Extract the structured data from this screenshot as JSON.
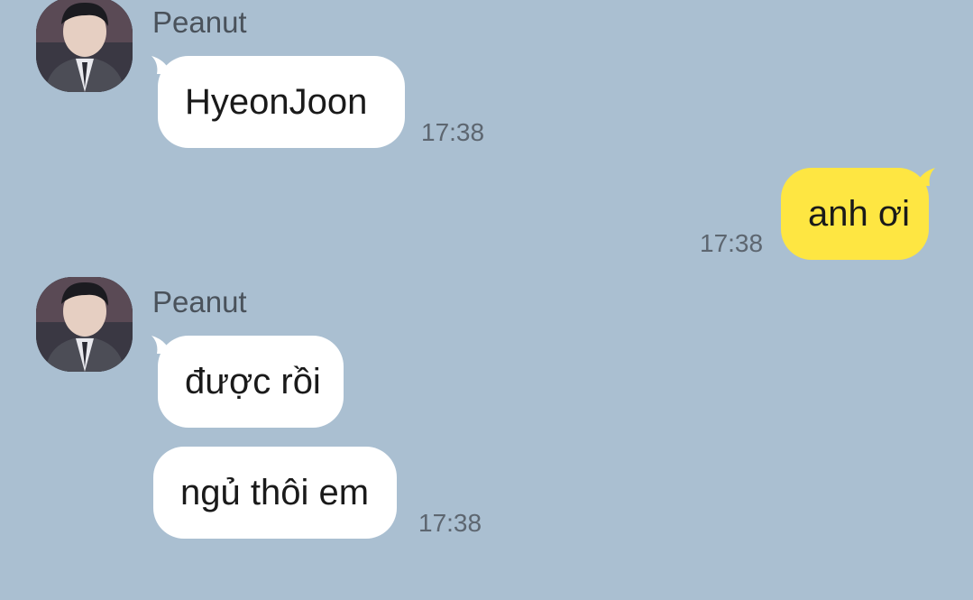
{
  "chat": {
    "messages": [
      {
        "sender": "Peanut",
        "text": "HyeonJoon",
        "time": "17:38"
      },
      {
        "sender": "me",
        "text": "anh ơi",
        "time": "17:38"
      },
      {
        "sender": "Peanut",
        "text": "được rồi",
        "time": ""
      },
      {
        "sender": "Peanut",
        "text": "ngủ thôi em",
        "time": "17:38"
      }
    ]
  },
  "colors": {
    "background": "#aabfd1",
    "incoming_bubble": "#ffffff",
    "outgoing_bubble": "#fee642"
  },
  "icons": {
    "avatar": "profile-photo"
  }
}
